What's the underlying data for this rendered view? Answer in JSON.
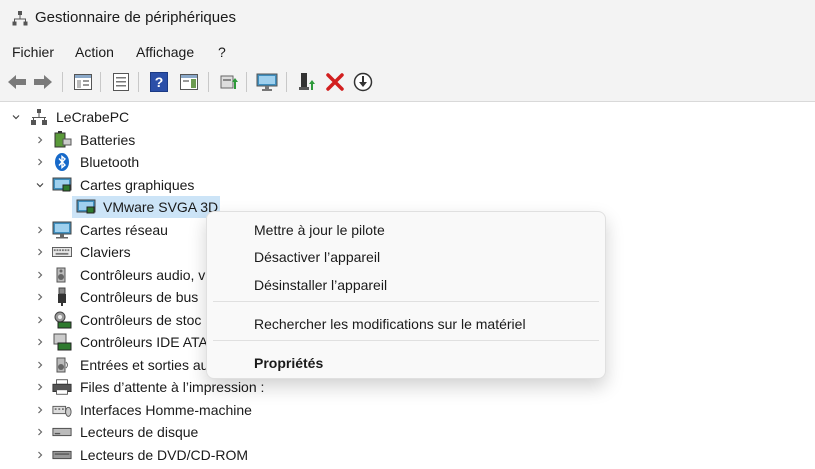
{
  "window": {
    "title": "Gestionnaire de périphériques"
  },
  "menu": [
    "Fichier",
    "Action",
    "Affichage",
    "?"
  ],
  "toolbar": {
    "buttons": [
      "back-arrow-icon",
      "forward-arrow-icon",
      "show-hide-tree-icon",
      "properties-icon",
      "help-icon",
      "action-pane-icon",
      "update-driver-icon",
      "scan-hardware-icon",
      "enable-device-icon",
      "uninstall-device-icon",
      "disable-device-icon"
    ]
  },
  "tree": {
    "root": "LeCrabePC",
    "categories": [
      {
        "label": "Batteries",
        "expanded": false
      },
      {
        "label": "Bluetooth",
        "expanded": false
      },
      {
        "label": "Cartes graphiques",
        "expanded": true
      },
      {
        "label": "Cartes réseau",
        "expanded": false
      },
      {
        "label": "Claviers",
        "expanded": false
      },
      {
        "label": "Contrôleurs audio, v",
        "expanded": false
      },
      {
        "label": "Contrôleurs de bus",
        "expanded": false
      },
      {
        "label": "Contrôleurs de stoc",
        "expanded": false
      },
      {
        "label": "Contrôleurs IDE ATA",
        "expanded": false
      },
      {
        "label": "Entrées et sorties au",
        "expanded": false
      },
      {
        "label": "Files d’attente à l’impression :",
        "expanded": false
      },
      {
        "label": "Interfaces Homme-machine",
        "expanded": false
      },
      {
        "label": "Lecteurs de disque",
        "expanded": false
      },
      {
        "label": "Lecteurs de DVD/CD-ROM",
        "expanded": false
      }
    ],
    "selected_device": "VMware SVGA 3D"
  },
  "context_menu": {
    "items": [
      "Mettre à jour le pilote",
      "Désactiver l’appareil",
      "Désinstaller l’appareil",
      "Rechercher les modifications sur le matériel",
      "Propriétés"
    ]
  },
  "colors": {
    "selection": "#cce4f7",
    "delete_red": "#d21f1f",
    "help_blue": "#2b4fa8",
    "bluetooth_blue": "#1769c9",
    "monitor_teal": "#3f8fbf"
  }
}
